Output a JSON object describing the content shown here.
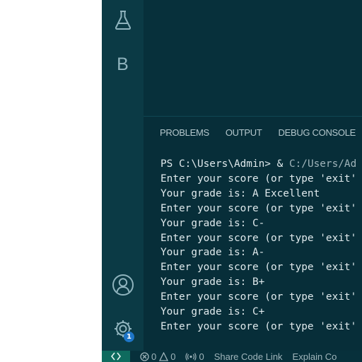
{
  "activity_bar": {
    "testing_icon": "flask-icon",
    "extension_letter": "B",
    "accounts_icon": "account-icon",
    "settings_icon": "gear-icon",
    "settings_badge": "1"
  },
  "panel": {
    "tabs": [
      {
        "label": "PROBLEMS"
      },
      {
        "label": "OUTPUT"
      },
      {
        "label": "DEBUG CONSOLE"
      }
    ],
    "terminal": {
      "prompt": "PS C:\\Users\\Admin> & ",
      "prompt_path": "C:/Users/Ad",
      "lines": [
        "Enter your score (or type 'exit'",
        "Your grade is: A Excellent",
        "Enter your score (or type 'exit'",
        "Your grade is: C-",
        "Enter your score (or type 'exit'",
        "Your grade is: A-",
        "Enter your score (or type 'exit'",
        "Your grade is: B+",
        "Enter your score (or type 'exit'",
        "Your grade is: C+",
        "Enter your score (or type 'exit'"
      ]
    }
  },
  "status_bar": {
    "errors": "0",
    "warnings": "0",
    "ports": "0",
    "share_label": "Share Code Link",
    "explain_label": "Explain Co"
  }
}
